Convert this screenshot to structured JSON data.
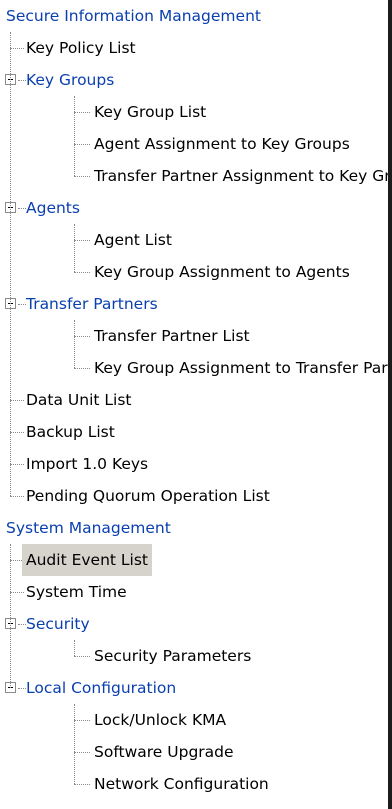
{
  "tree": {
    "sections": [
      {
        "label": "Secure Information Management",
        "items": [
          {
            "label": "Key Policy List"
          },
          {
            "label": "Key Groups",
            "expanded": true,
            "children": [
              {
                "label": "Key Group List"
              },
              {
                "label": "Agent Assignment to Key Groups"
              },
              {
                "label": "Transfer Partner Assignment to Key Groups"
              }
            ]
          },
          {
            "label": "Agents",
            "expanded": true,
            "children": [
              {
                "label": "Agent List"
              },
              {
                "label": "Key Group Assignment to Agents"
              }
            ]
          },
          {
            "label": "Transfer Partners",
            "expanded": true,
            "children": [
              {
                "label": "Transfer Partner List"
              },
              {
                "label": "Key Group Assignment to Transfer Partners"
              }
            ]
          },
          {
            "label": "Data Unit List"
          },
          {
            "label": "Backup List"
          },
          {
            "label": "Import 1.0 Keys"
          },
          {
            "label": "Pending Quorum Operation List"
          }
        ]
      },
      {
        "label": "System Management",
        "items": [
          {
            "label": "Audit Event List",
            "selected": true
          },
          {
            "label": "System Time"
          },
          {
            "label": "Security",
            "expanded": true,
            "children": [
              {
                "label": "Security Parameters"
              }
            ]
          },
          {
            "label": "Local Configuration",
            "expanded": true,
            "children": [
              {
                "label": "Lock/Unlock KMA"
              },
              {
                "label": "Software Upgrade"
              },
              {
                "label": "Network Configuration"
              }
            ]
          }
        ]
      }
    ]
  },
  "colors": {
    "link": "#0a3fb0",
    "selected_bg": "#d6d2cc",
    "tree_line": "#8a8a8a",
    "border": "#1b1b1b"
  }
}
